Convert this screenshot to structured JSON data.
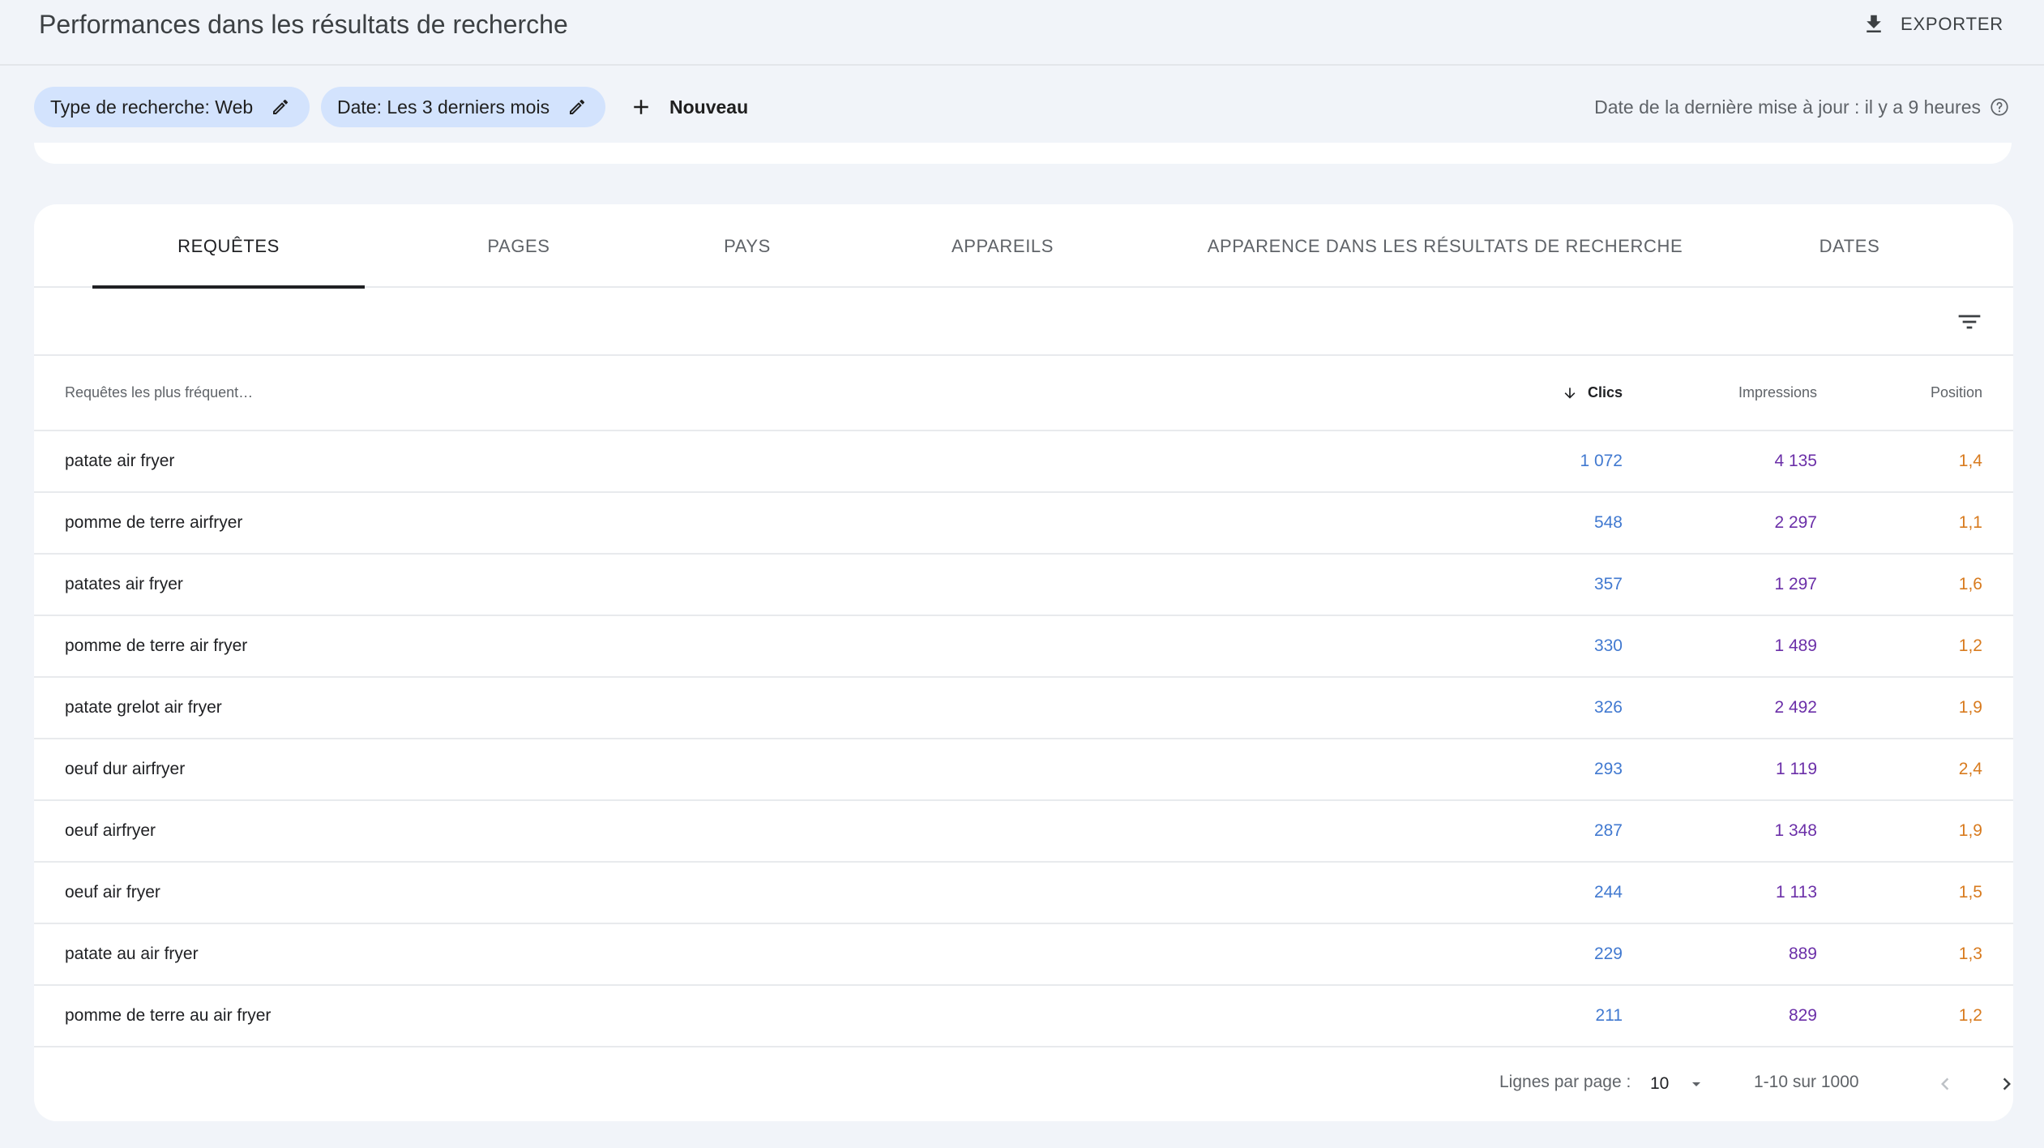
{
  "header": {
    "title": "Performances dans les résultats de recherche",
    "export_label": "EXPORTER"
  },
  "filters": {
    "chips": [
      {
        "label": "Type de recherche: Web"
      },
      {
        "label": "Date: Les 3 derniers mois"
      }
    ],
    "new_label": "Nouveau",
    "last_update": "Date de la dernière mise à jour : il y a 9 heures"
  },
  "tabs": [
    {
      "label": "REQUÊTES",
      "active": true
    },
    {
      "label": "PAGES",
      "active": false
    },
    {
      "label": "PAYS",
      "active": false
    },
    {
      "label": "APPAREILS",
      "active": false
    },
    {
      "label": "APPARENCE DANS LES RÉSULTATS DE RECHERCHE",
      "active": false
    },
    {
      "label": "DATES",
      "active": false
    }
  ],
  "table": {
    "columns": {
      "query": "Requêtes les plus fréquent…",
      "clicks": "Clics",
      "impressions": "Impressions",
      "position": "Position"
    },
    "sort_column": "clicks",
    "rows": [
      {
        "query": "patate air fryer",
        "clicks": "1 072",
        "impressions": "4 135",
        "position": "1,4"
      },
      {
        "query": "pomme de terre airfryer",
        "clicks": "548",
        "impressions": "2 297",
        "position": "1,1"
      },
      {
        "query": "patates air fryer",
        "clicks": "357",
        "impressions": "1 297",
        "position": "1,6"
      },
      {
        "query": "pomme de terre air fryer",
        "clicks": "330",
        "impressions": "1 489",
        "position": "1,2"
      },
      {
        "query": "patate grelot air fryer",
        "clicks": "326",
        "impressions": "2 492",
        "position": "1,9"
      },
      {
        "query": "oeuf dur airfryer",
        "clicks": "293",
        "impressions": "1 119",
        "position": "2,4"
      },
      {
        "query": "oeuf airfryer",
        "clicks": "287",
        "impressions": "1 348",
        "position": "1,9"
      },
      {
        "query": "oeuf air fryer",
        "clicks": "244",
        "impressions": "1 113",
        "position": "1,5"
      },
      {
        "query": "patate au air fryer",
        "clicks": "229",
        "impressions": "889",
        "position": "1,3"
      },
      {
        "query": "pomme de terre au air fryer",
        "clicks": "211",
        "impressions": "829",
        "position": "1,2"
      }
    ]
  },
  "pagination": {
    "rows_per_page_label": "Lignes par page :",
    "rows_per_page_value": "10",
    "range": "1-10 sur 1000"
  },
  "colors": {
    "background": "#f1f4f9",
    "chip": "#d3e3fd",
    "clicks": "#4179d0",
    "impressions": "#6b2fa8",
    "position": "#d87b1f"
  }
}
